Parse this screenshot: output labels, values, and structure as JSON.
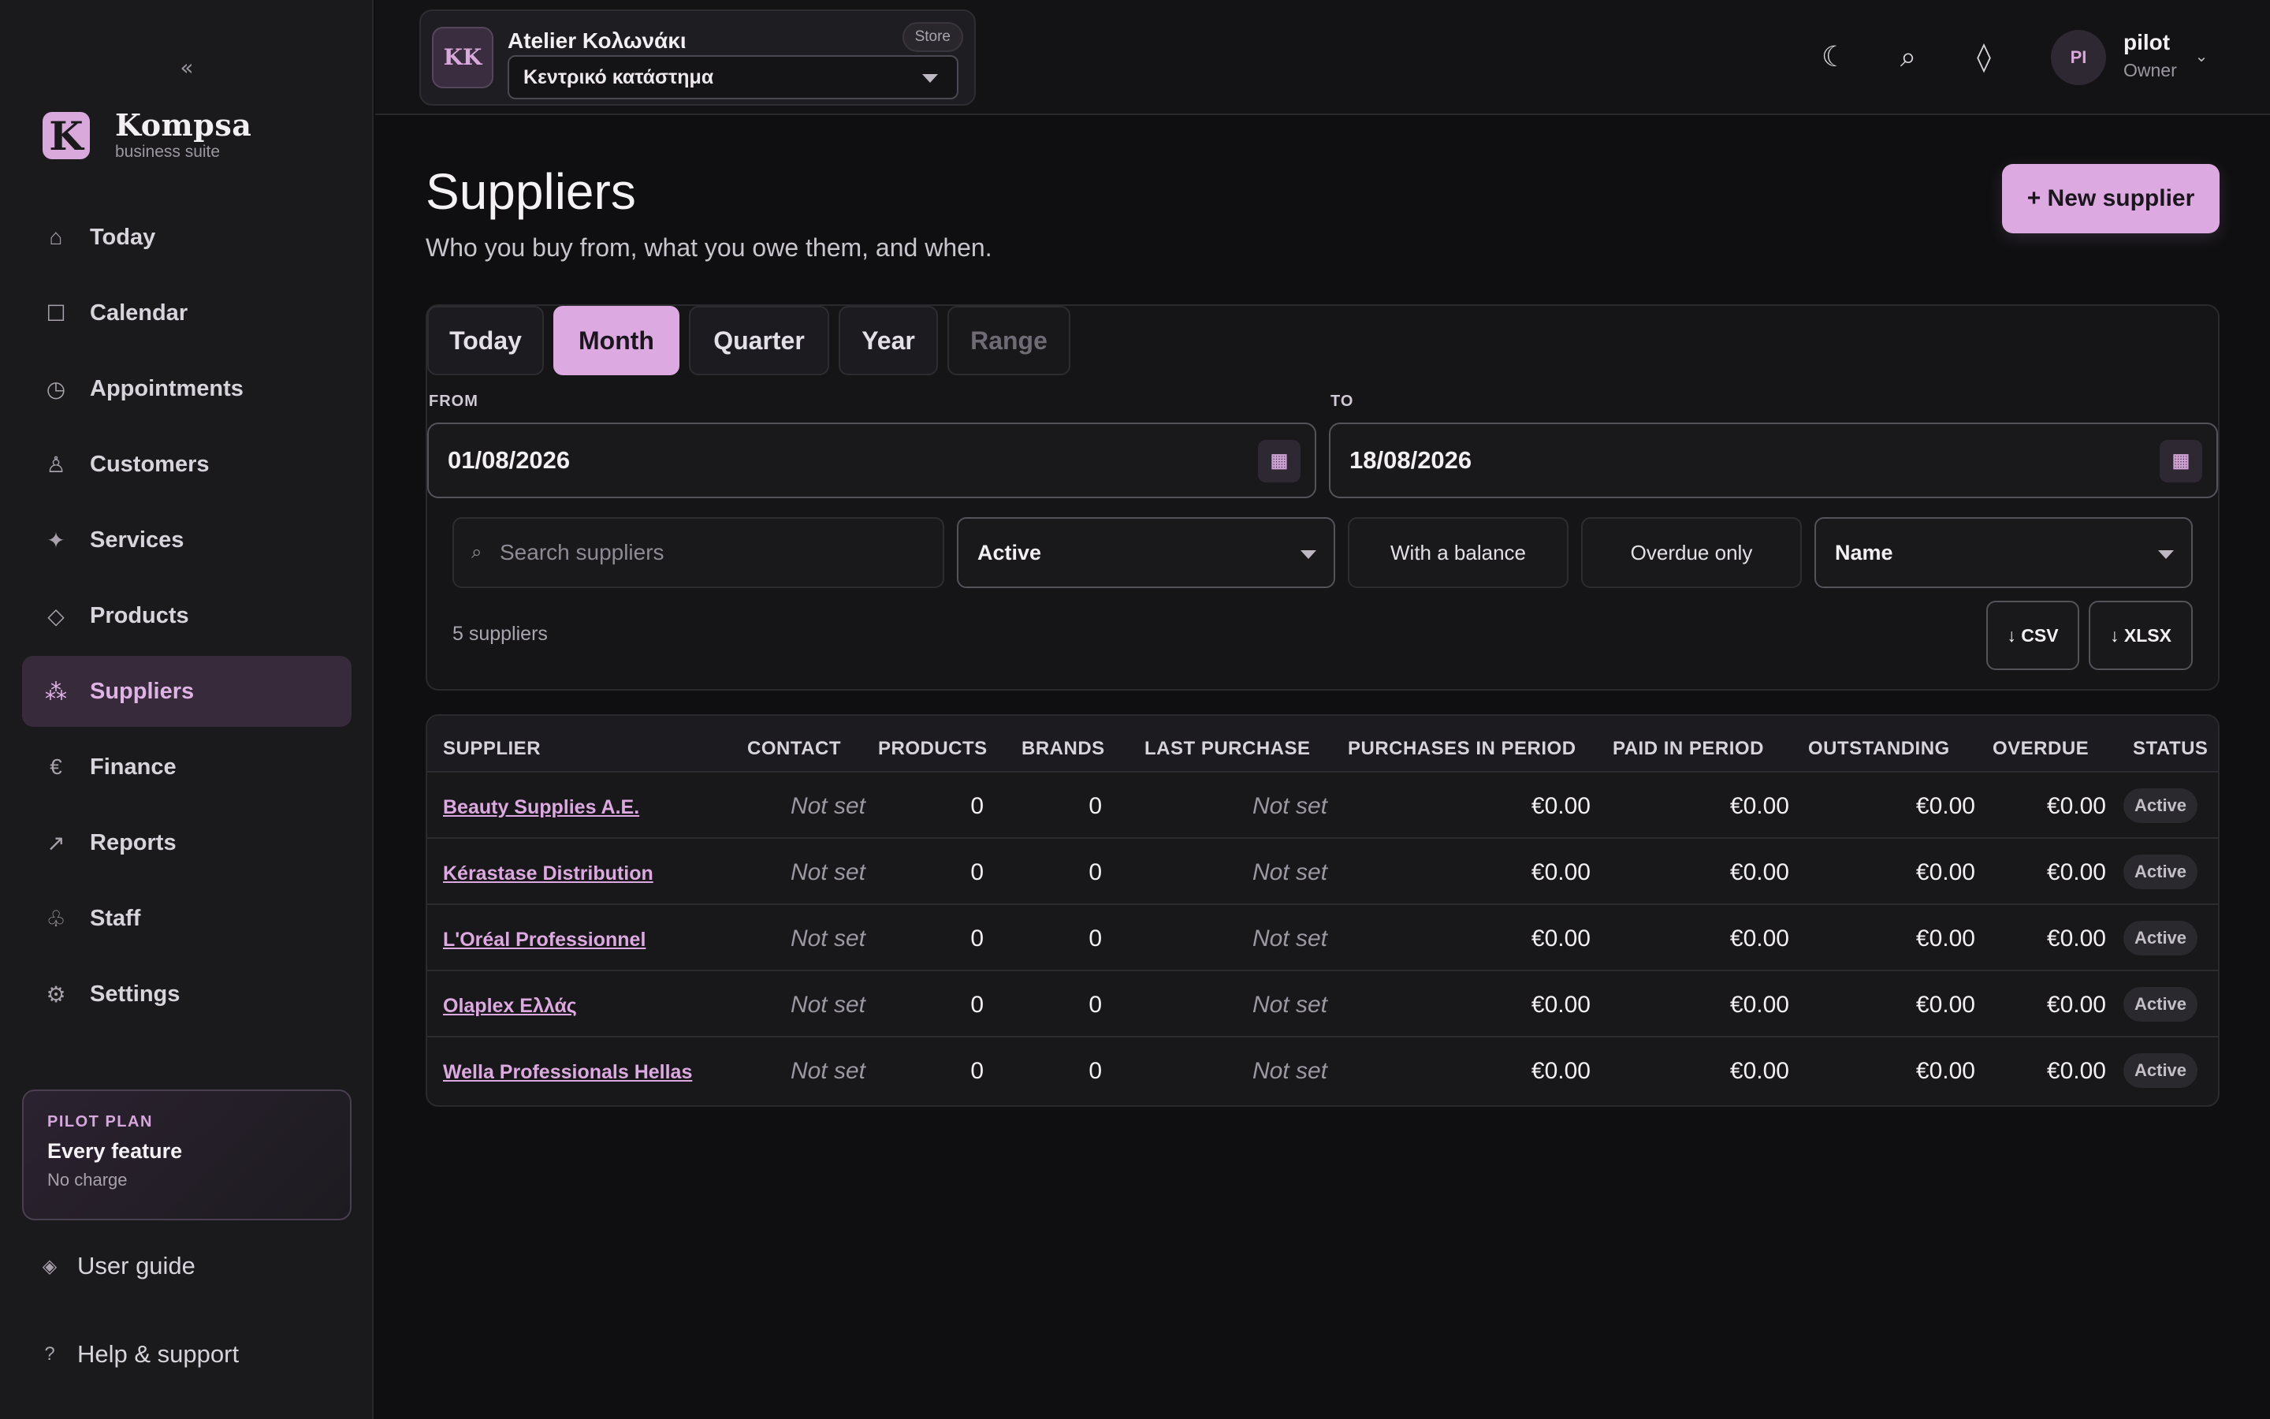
{
  "sidebar": {
    "collapse_glyph": "«",
    "brand": {
      "name": "Kompsa",
      "subtitle": "business suite",
      "logo_letter": "K"
    },
    "nav": [
      {
        "label": "Today",
        "icon": "home-icon",
        "glyph": "⌂"
      },
      {
        "label": "Calendar",
        "icon": "calendar-icon",
        "glyph": "☐"
      },
      {
        "label": "Appointments",
        "icon": "clock-icon",
        "glyph": "◷"
      },
      {
        "label": "Customers",
        "icon": "person-icon",
        "glyph": "♙"
      },
      {
        "label": "Services",
        "icon": "sparkle-icon",
        "glyph": "✦"
      },
      {
        "label": "Products",
        "icon": "diamond-icon",
        "glyph": "◇"
      },
      {
        "label": "Suppliers",
        "icon": "dots-icon",
        "glyph": "⁂",
        "active": true
      },
      {
        "label": "Finance",
        "icon": "euro-icon",
        "glyph": "€"
      },
      {
        "label": "Reports",
        "icon": "arrow-up-right-icon",
        "glyph": "↗"
      },
      {
        "label": "Staff",
        "icon": "staff-icon",
        "glyph": "♧"
      },
      {
        "label": "Settings",
        "icon": "gear-icon",
        "glyph": "⚙"
      }
    ],
    "plan": {
      "kicker": "PILOT PLAN",
      "title": "Every feature",
      "note": "No charge"
    },
    "user_guide": {
      "label": "User guide",
      "glyph": "◈"
    },
    "help": {
      "label": "Help & support",
      "glyph": "?"
    }
  },
  "topbar": {
    "store": {
      "initials": "KK",
      "name": "Atelier Κολωνάκι",
      "badge": "Store",
      "location": "Κεντρικό κατάστημα"
    },
    "icons": {
      "theme": "☾",
      "search": "⌕",
      "diamond": "◊",
      "chevron": "⌄"
    },
    "user": {
      "initials": "PI",
      "name": "pilot",
      "role": "Owner"
    }
  },
  "page": {
    "title": "Suppliers",
    "subtitle": "Who you buy from, what you owe them, and when.",
    "new_button": "+ New supplier"
  },
  "filters": {
    "periods": [
      {
        "label": "Today"
      },
      {
        "label": "Month",
        "active": true
      },
      {
        "label": "Quarter"
      },
      {
        "label": "Year"
      },
      {
        "label": "Range",
        "disabled": true
      }
    ],
    "from_label": "FROM",
    "from_value": "01/08/2026",
    "to_label": "TO",
    "to_value": "18/08/2026",
    "calendar_glyph": "▦",
    "search_placeholder": "Search suppliers",
    "search_glyph": "⌕",
    "status_select": "Active",
    "with_balance": "With a balance",
    "overdue_only": "Overdue only",
    "sort_select": "Name",
    "count": "5 suppliers",
    "export_csv": "↓ CSV",
    "export_xlsx": "↓ XLSX"
  },
  "table": {
    "headers": [
      "SUPPLIER",
      "CONTACT",
      "PRODUCTS",
      "BRANDS",
      "LAST PURCHASE",
      "PURCHASES IN PERIOD",
      "PAID IN PERIOD",
      "OUTSTANDING",
      "OVERDUE",
      "STATUS"
    ],
    "rows": [
      {
        "supplier": "Beauty Supplies A.E.",
        "contact": "Not set",
        "products": "0",
        "brands": "0",
        "last_purchase": "Not set",
        "purchases": "€0.00",
        "paid": "€0.00",
        "outstanding": "€0.00",
        "overdue": "€0.00",
        "status": "Active"
      },
      {
        "supplier": "Kérastase Distribution",
        "contact": "Not set",
        "products": "0",
        "brands": "0",
        "last_purchase": "Not set",
        "purchases": "€0.00",
        "paid": "€0.00",
        "outstanding": "€0.00",
        "overdue": "€0.00",
        "status": "Active"
      },
      {
        "supplier": "L'Oréal Professionnel",
        "contact": "Not set",
        "products": "0",
        "brands": "0",
        "last_purchase": "Not set",
        "purchases": "€0.00",
        "paid": "€0.00",
        "outstanding": "€0.00",
        "overdue": "€0.00",
        "status": "Active"
      },
      {
        "supplier": "Olaplex Ελλάς",
        "contact": "Not set",
        "products": "0",
        "brands": "0",
        "last_purchase": "Not set",
        "purchases": "€0.00",
        "paid": "€0.00",
        "outstanding": "€0.00",
        "overdue": "€0.00",
        "status": "Active"
      },
      {
        "supplier": "Wella Professionals Hellas",
        "contact": "Not set",
        "products": "0",
        "brands": "0",
        "last_purchase": "Not set",
        "purchases": "€0.00",
        "paid": "€0.00",
        "outstanding": "€0.00",
        "overdue": "€0.00",
        "status": "Active"
      }
    ]
  },
  "colors": {
    "accent": "#dcaae0",
    "background": "#0f0f11",
    "sidebar": "#1a191c",
    "active_nav": "#362a3b"
  }
}
